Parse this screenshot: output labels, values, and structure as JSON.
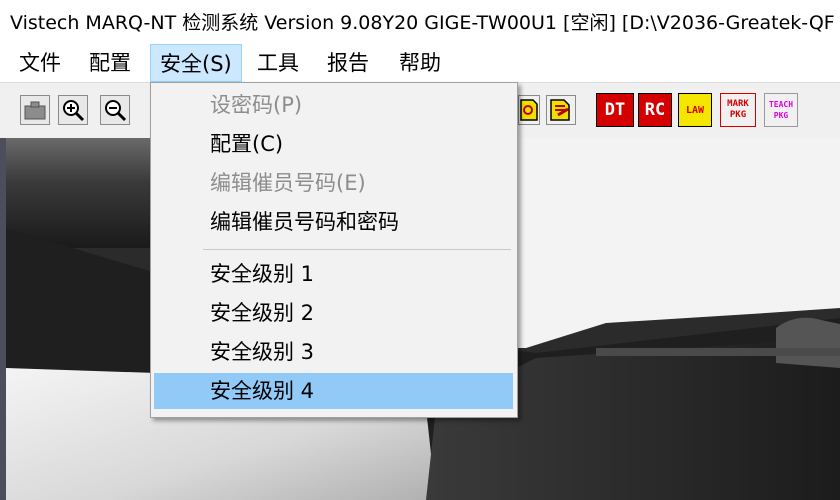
{
  "window": {
    "title": "Vistech MARQ-NT 检测系统 Version 9.08Y20 GIGE-TW00U1 [空闲] [D:\\V2036-Greatek-QF"
  },
  "menubar": {
    "items": [
      "文件",
      "配置",
      "安全(S)",
      "工具",
      "报告",
      "帮助"
    ],
    "active": "安全(S)"
  },
  "toolbar": {
    "icons": [
      "camera-icon",
      "zoom-in-icon",
      "zoom-out-icon"
    ],
    "labels": {
      "dt": "DT",
      "rc": "RC",
      "law": "LAW",
      "mark_pkg_top": "MARK",
      "mark_pkg_bottom": "PKG",
      "teach_pkg_top": "TEACH",
      "teach_pkg_bottom": "PKG"
    },
    "colors": {
      "dt_bg": "#d40000",
      "rc_bg": "#d40000",
      "law_bg": "#f5e600",
      "mark_fg": "#d40000",
      "teach_fg": "#e000e0"
    }
  },
  "security_menu": {
    "items": [
      {
        "label": "设密码(P)",
        "enabled": false
      },
      {
        "label": "配置(C)",
        "enabled": true
      },
      {
        "label": "编辑催员号码(E)",
        "enabled": false
      },
      {
        "label": "编辑催员号码和密码",
        "enabled": true
      },
      {
        "label": "安全级别 1",
        "enabled": true
      },
      {
        "label": "安全级别 2",
        "enabled": true
      },
      {
        "label": "安全级别 3",
        "enabled": true
      },
      {
        "label": "安全级别 4",
        "enabled": true,
        "highlighted": true
      }
    ]
  }
}
